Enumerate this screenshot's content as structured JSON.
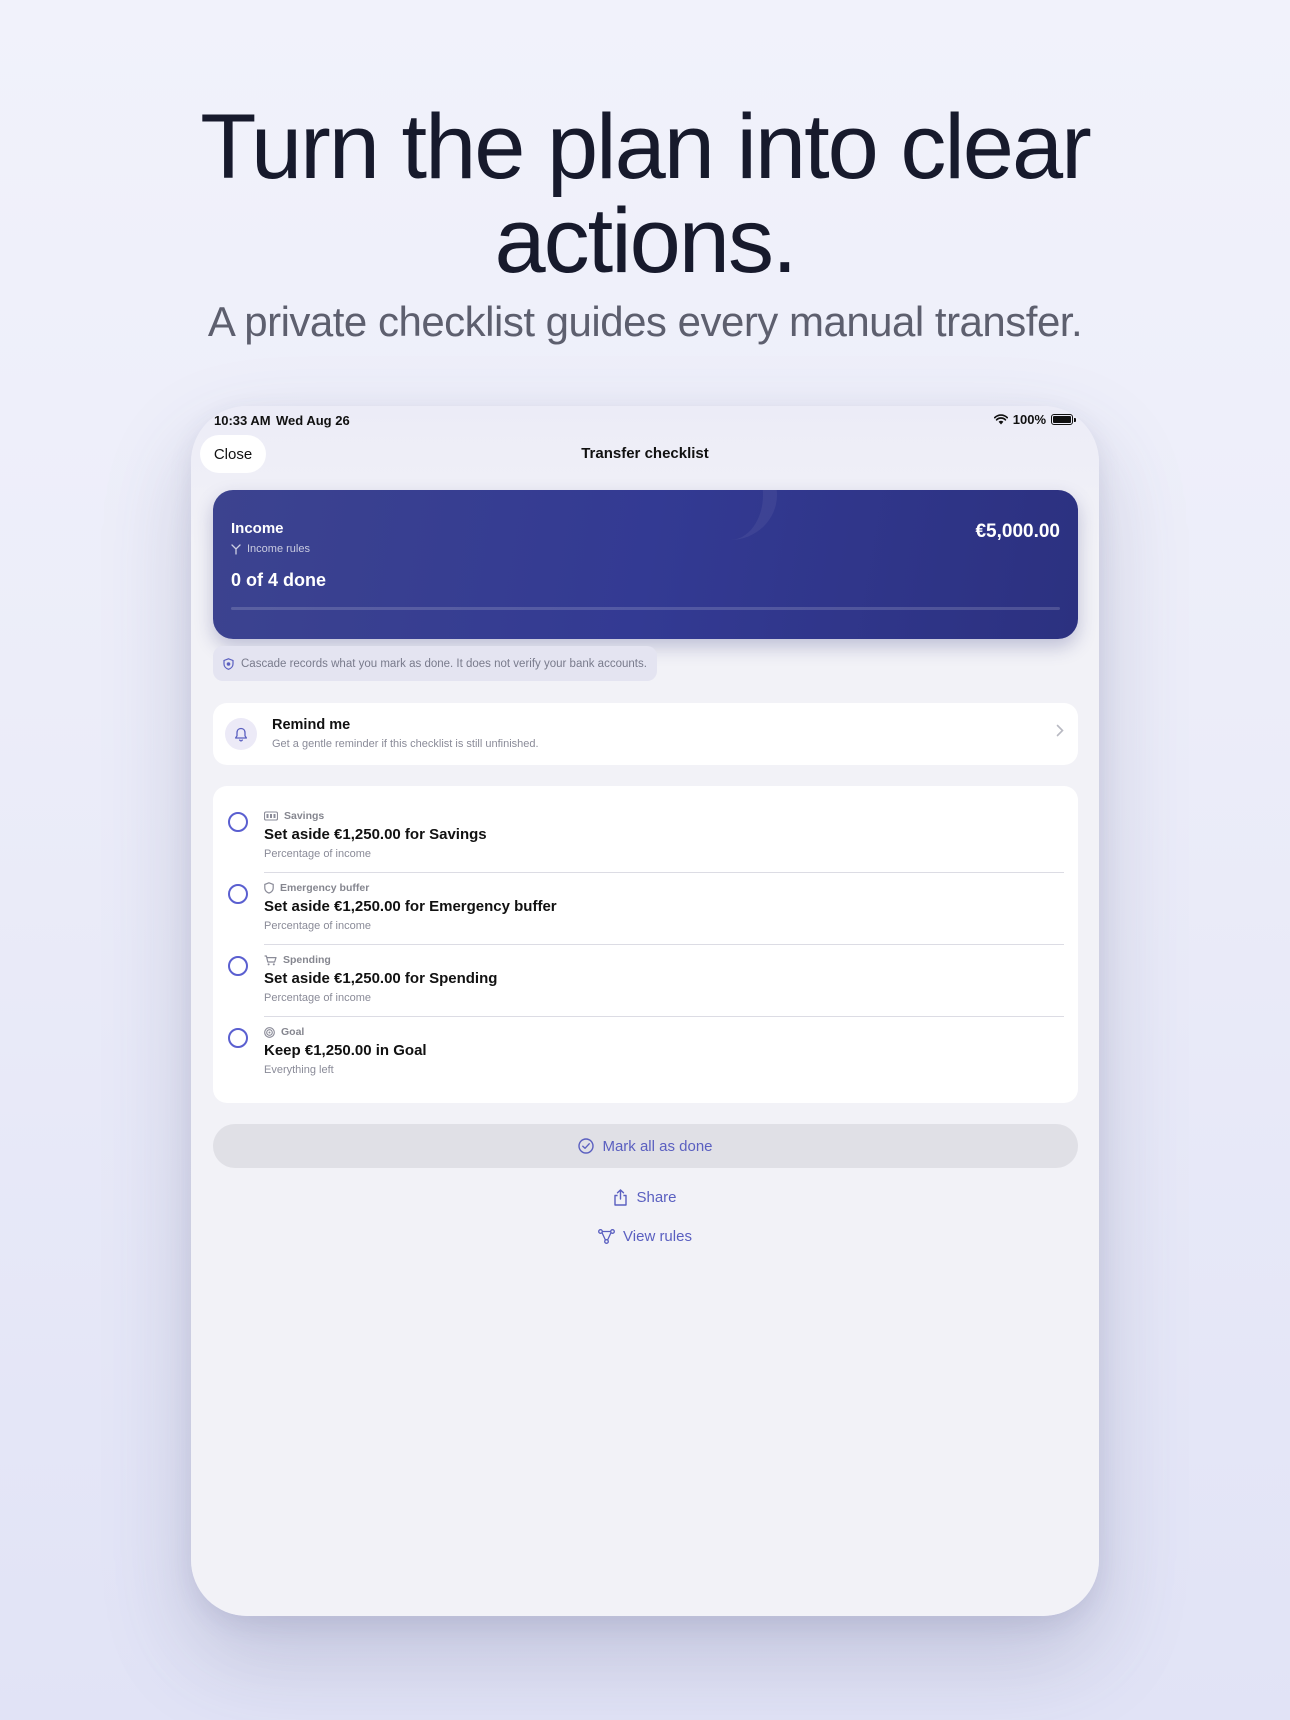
{
  "hero": {
    "headline_line1": "Turn the plan into clear",
    "headline_line2": "actions.",
    "subhead": "A private checklist guides every manual transfer."
  },
  "status_bar": {
    "time": "10:33 AM",
    "date": "Wed Aug 26",
    "battery": "100%"
  },
  "nav": {
    "close_label": "Close",
    "title": "Transfer checklist"
  },
  "income_card": {
    "label": "Income",
    "rules_label": "Income rules",
    "amount": "€5,000.00",
    "progress_text": "0 of 4 done",
    "progress_fraction": 0
  },
  "notice": {
    "text": "Cascade records what you mark as done. It does not verify your bank accounts."
  },
  "reminder": {
    "title": "Remind me",
    "subtitle": "Get a gentle reminder if this checklist is still unfinished."
  },
  "tasks": [
    {
      "category": "Savings",
      "icon": "savings-icon",
      "title": "Set aside €1,250.00 for Savings",
      "subtitle": "Percentage of income"
    },
    {
      "category": "Emergency buffer",
      "icon": "shield-icon",
      "title": "Set aside €1,250.00 for Emergency buffer",
      "subtitle": "Percentage of income"
    },
    {
      "category": "Spending",
      "icon": "cart-icon",
      "title": "Set aside €1,250.00 for Spending",
      "subtitle": "Percentage of income"
    },
    {
      "category": "Goal",
      "icon": "target-icon",
      "title": "Keep €1,250.00 in Goal",
      "subtitle": "Everything left"
    }
  ],
  "actions": {
    "mark_all_label": "Mark all as done",
    "share_label": "Share",
    "view_rules_label": "View rules"
  },
  "colors": {
    "accent": "#5a5fc0",
    "card_start": "#3c438f",
    "card_end": "#2c3180",
    "background": "#eceef9"
  }
}
